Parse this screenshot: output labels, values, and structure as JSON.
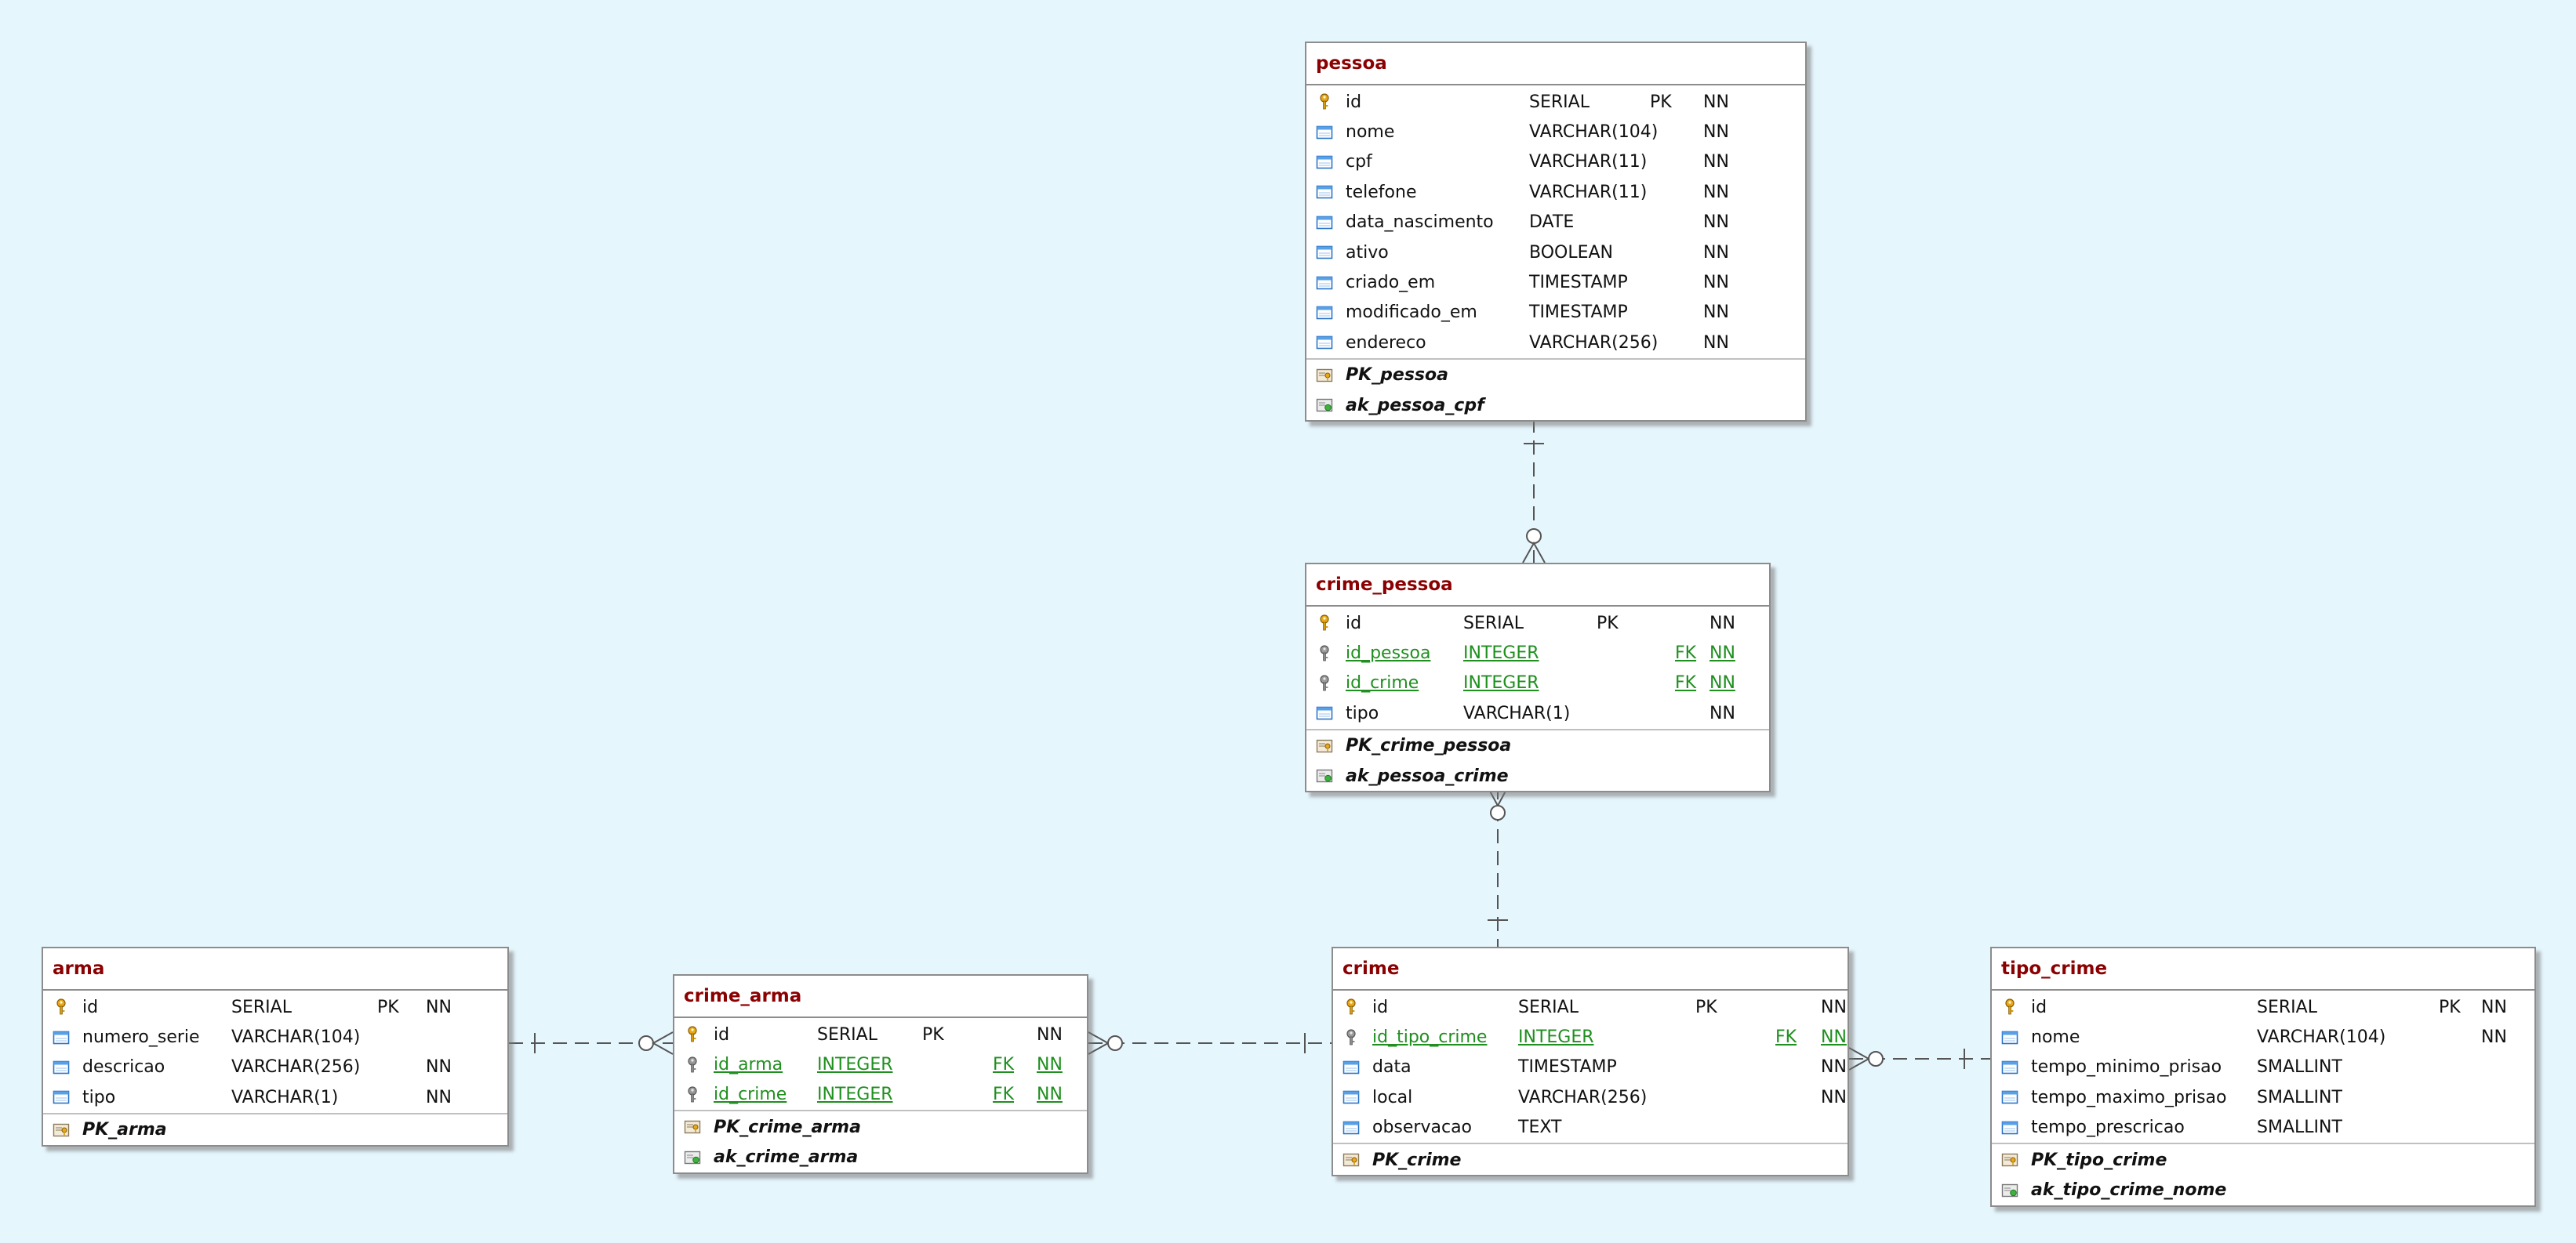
{
  "colors": {
    "background": "#e6f6fd",
    "title": "#8b0000",
    "fk": "#1f8f1f",
    "line": "#555555"
  },
  "entities": {
    "pessoa": {
      "title": "pessoa",
      "columns": [
        {
          "icon": "primary-key-icon",
          "name": "id",
          "type": "SERIAL",
          "pk": "PK",
          "fk": "",
          "nn": "NN"
        },
        {
          "icon": "column-icon",
          "name": "nome",
          "type": "VARCHAR(104)",
          "pk": "",
          "fk": "",
          "nn": "NN"
        },
        {
          "icon": "column-icon",
          "name": "cpf",
          "type": "VARCHAR(11)",
          "pk": "",
          "fk": "",
          "nn": "NN"
        },
        {
          "icon": "column-icon",
          "name": "telefone",
          "type": "VARCHAR(11)",
          "pk": "",
          "fk": "",
          "nn": "NN"
        },
        {
          "icon": "column-icon",
          "name": "data_nascimento",
          "type": "DATE",
          "pk": "",
          "fk": "",
          "nn": "NN"
        },
        {
          "icon": "column-icon",
          "name": "ativo",
          "type": "BOOLEAN",
          "pk": "",
          "fk": "",
          "nn": "NN"
        },
        {
          "icon": "column-icon",
          "name": "criado_em",
          "type": "TIMESTAMP",
          "pk": "",
          "fk": "",
          "nn": "NN"
        },
        {
          "icon": "column-icon",
          "name": "modificado_em",
          "type": "TIMESTAMP",
          "pk": "",
          "fk": "",
          "nn": "NN"
        },
        {
          "icon": "column-icon",
          "name": "endereco",
          "type": "VARCHAR(256)",
          "pk": "",
          "fk": "",
          "nn": "NN"
        }
      ],
      "keys": [
        {
          "icon": "pk-constraint-icon",
          "name": "PK_pessoa"
        },
        {
          "icon": "unique-constraint-icon",
          "name": "ak_pessoa_cpf"
        }
      ]
    },
    "crime_pessoa": {
      "title": "crime_pessoa",
      "columns": [
        {
          "icon": "primary-key-icon",
          "name": "id",
          "type": "SERIAL",
          "pk": "PK",
          "fk": "",
          "nn": "NN"
        },
        {
          "icon": "foreign-key-icon",
          "name": "id_pessoa",
          "type": "INTEGER",
          "pk": "",
          "fk": "FK",
          "nn": "NN"
        },
        {
          "icon": "foreign-key-icon",
          "name": "id_crime",
          "type": "INTEGER",
          "pk": "",
          "fk": "FK",
          "nn": "NN"
        },
        {
          "icon": "column-icon",
          "name": "tipo",
          "type": "VARCHAR(1)",
          "pk": "",
          "fk": "",
          "nn": "NN"
        }
      ],
      "keys": [
        {
          "icon": "pk-constraint-icon",
          "name": "PK_crime_pessoa"
        },
        {
          "icon": "unique-constraint-icon",
          "name": "ak_pessoa_crime"
        }
      ]
    },
    "arma": {
      "title": "arma",
      "columns": [
        {
          "icon": "primary-key-icon",
          "name": "id",
          "type": "SERIAL",
          "pk": "PK",
          "fk": "",
          "nn": "NN"
        },
        {
          "icon": "column-icon",
          "name": "numero_serie",
          "type": "VARCHAR(104)",
          "pk": "",
          "fk": "",
          "nn": ""
        },
        {
          "icon": "column-icon",
          "name": "descricao",
          "type": "VARCHAR(256)",
          "pk": "",
          "fk": "",
          "nn": "NN"
        },
        {
          "icon": "column-icon",
          "name": "tipo",
          "type": "VARCHAR(1)",
          "pk": "",
          "fk": "",
          "nn": "NN"
        }
      ],
      "keys": [
        {
          "icon": "pk-constraint-icon",
          "name": "PK_arma"
        }
      ]
    },
    "crime_arma": {
      "title": "crime_arma",
      "columns": [
        {
          "icon": "primary-key-icon",
          "name": "id",
          "type": "SERIAL",
          "pk": "PK",
          "fk": "",
          "nn": "NN"
        },
        {
          "icon": "foreign-key-icon",
          "name": "id_arma",
          "type": "INTEGER",
          "pk": "",
          "fk": "FK",
          "nn": "NN"
        },
        {
          "icon": "foreign-key-icon",
          "name": "id_crime",
          "type": "INTEGER",
          "pk": "",
          "fk": "FK",
          "nn": "NN"
        }
      ],
      "keys": [
        {
          "icon": "pk-constraint-icon",
          "name": "PK_crime_arma"
        },
        {
          "icon": "unique-constraint-icon",
          "name": "ak_crime_arma"
        }
      ]
    },
    "crime": {
      "title": "crime",
      "columns": [
        {
          "icon": "primary-key-icon",
          "name": "id",
          "type": "SERIAL",
          "pk": "PK",
          "fk": "",
          "nn": "NN"
        },
        {
          "icon": "foreign-key-icon",
          "name": "id_tipo_crime",
          "type": "INTEGER",
          "pk": "",
          "fk": "FK",
          "nn": "NN"
        },
        {
          "icon": "column-icon",
          "name": "data",
          "type": "TIMESTAMP",
          "pk": "",
          "fk": "",
          "nn": "NN"
        },
        {
          "icon": "column-icon",
          "name": "local",
          "type": "VARCHAR(256)",
          "pk": "",
          "fk": "",
          "nn": "NN"
        },
        {
          "icon": "column-icon",
          "name": "observacao",
          "type": "TEXT",
          "pk": "",
          "fk": "",
          "nn": ""
        }
      ],
      "keys": [
        {
          "icon": "pk-constraint-icon",
          "name": "PK_crime"
        }
      ]
    },
    "tipo_crime": {
      "title": "tipo_crime",
      "columns": [
        {
          "icon": "primary-key-icon",
          "name": "id",
          "type": "SERIAL",
          "pk": "PK",
          "fk": "",
          "nn": "NN"
        },
        {
          "icon": "column-icon",
          "name": "nome",
          "type": "VARCHAR(104)",
          "pk": "",
          "fk": "",
          "nn": "NN"
        },
        {
          "icon": "column-icon",
          "name": "tempo_minimo_prisao",
          "type": "SMALLINT",
          "pk": "",
          "fk": "",
          "nn": ""
        },
        {
          "icon": "column-icon",
          "name": "tempo_maximo_prisao",
          "type": "SMALLINT",
          "pk": "",
          "fk": "",
          "nn": ""
        },
        {
          "icon": "column-icon",
          "name": "tempo_prescricao",
          "type": "SMALLINT",
          "pk": "",
          "fk": "",
          "nn": ""
        }
      ],
      "keys": [
        {
          "icon": "pk-constraint-icon",
          "name": "PK_tipo_crime"
        },
        {
          "icon": "unique-constraint-icon",
          "name": "ak_tipo_crime_nome"
        }
      ]
    }
  },
  "relationships": [
    {
      "from": "pessoa",
      "to": "crime_pessoa",
      "from_card": "one",
      "to_card": "zero-or-many"
    },
    {
      "from": "crime",
      "to": "crime_pessoa",
      "from_card": "one",
      "to_card": "zero-or-many"
    },
    {
      "from": "arma",
      "to": "crime_arma",
      "from_card": "one",
      "to_card": "zero-or-many"
    },
    {
      "from": "crime",
      "to": "crime_arma",
      "from_card": "one",
      "to_card": "zero-or-many"
    },
    {
      "from": "tipo_crime",
      "to": "crime",
      "from_card": "one",
      "to_card": "zero-or-many"
    }
  ]
}
